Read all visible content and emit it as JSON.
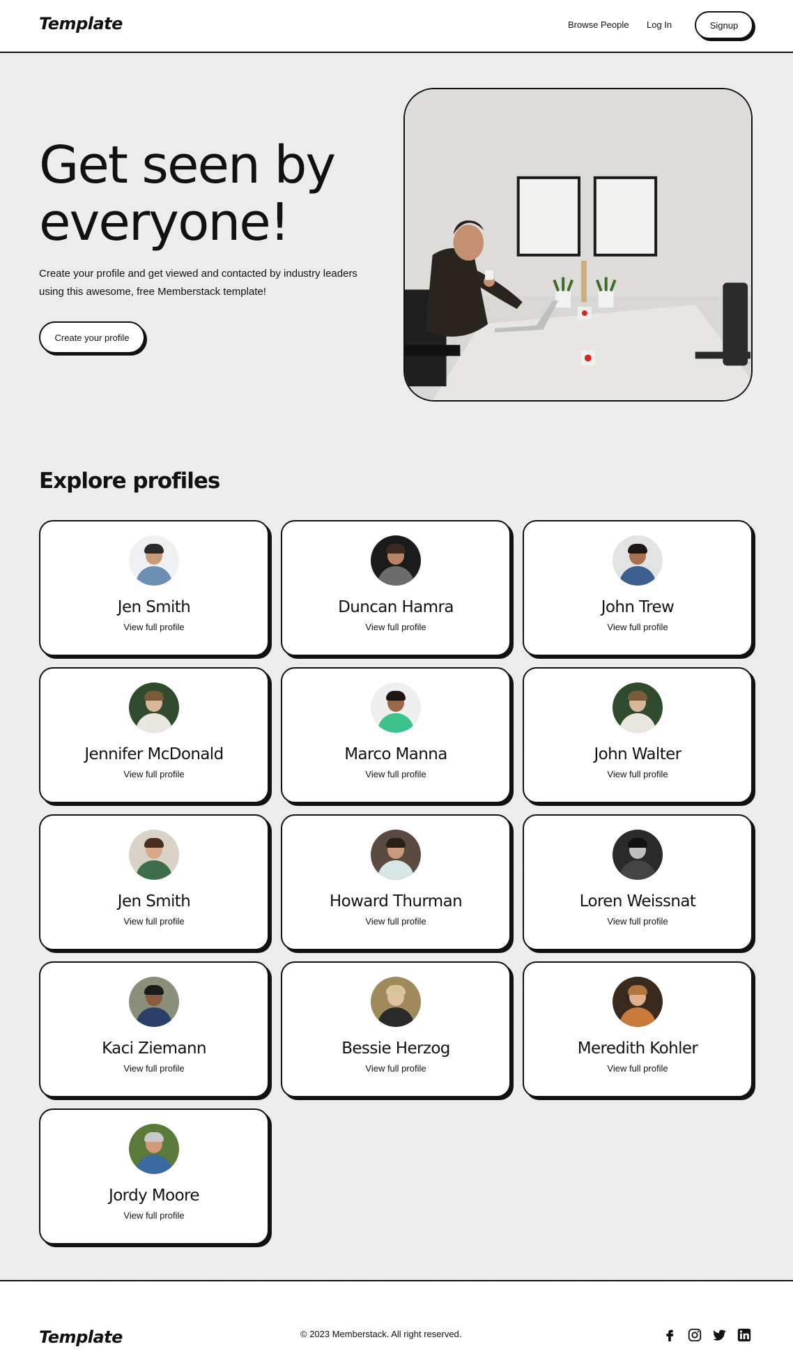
{
  "header": {
    "logo": "Template",
    "nav": {
      "browse": "Browse People",
      "login": "Log In",
      "signup": "Signup"
    }
  },
  "hero": {
    "title": "Get seen by everyone!",
    "description": "Create your profile and get viewed and contacted by industry leaders using this awesome, free Memberstack template!",
    "button": "Create your profile"
  },
  "profiles": {
    "title": "Explore profiles",
    "link_label": "View full profile",
    "items": [
      {
        "name": "Jen Smith",
        "colors": {
          "bg": "#eef0f2",
          "skin": "#c99a78",
          "shirt": "#6c8fb3",
          "hair": "#2a2a2a"
        }
      },
      {
        "name": "Duncan Hamra",
        "colors": {
          "bg": "#1b1b1b",
          "skin": "#b98466",
          "shirt": "#6b6b6b",
          "hair": "#3a2a20"
        }
      },
      {
        "name": "John Trew",
        "colors": {
          "bg": "#e3e3e3",
          "skin": "#a8704f",
          "shirt": "#3c5f8f",
          "hair": "#1e1712"
        }
      },
      {
        "name": "Jennifer McDonald",
        "colors": {
          "bg": "#2f4a2c",
          "skin": "#d8b69a",
          "shirt": "#e9e6df",
          "hair": "#7a5c3a"
        }
      },
      {
        "name": "Marco Manna",
        "colors": {
          "bg": "#eeeeee",
          "skin": "#9a6748",
          "shirt": "#3cc28a",
          "hair": "#1f1712"
        }
      },
      {
        "name": "John Walter",
        "colors": {
          "bg": "#2f4a2c",
          "skin": "#d8b69a",
          "shirt": "#e9e6df",
          "hair": "#7a5c3a"
        }
      },
      {
        "name": "Jen Smith",
        "colors": {
          "bg": "#d9d2c6",
          "skin": "#d8a888",
          "shirt": "#3f6f4a",
          "hair": "#4a2e1e"
        }
      },
      {
        "name": "Howard Thurman",
        "colors": {
          "bg": "#5a4a40",
          "skin": "#c99a7c",
          "shirt": "#d9e4e4",
          "hair": "#2a201a"
        }
      },
      {
        "name": "Loren Weissnat",
        "colors": {
          "bg": "#2a2a2a",
          "skin": "#bfbfbf",
          "shirt": "#444444",
          "hair": "#111111"
        }
      },
      {
        "name": "Kaci Ziemann",
        "colors": {
          "bg": "#8a8f7a",
          "skin": "#8a5a40",
          "shirt": "#2a3f6a",
          "hair": "#1a1a1a"
        }
      },
      {
        "name": "Bessie Herzog",
        "colors": {
          "bg": "#a08a5c",
          "skin": "#e0c0a0",
          "shirt": "#2a2a2a",
          "hair": "#d8c49a"
        }
      },
      {
        "name": "Meredith Kohler",
        "colors": {
          "bg": "#3a2a1e",
          "skin": "#e0b08a",
          "shirt": "#c97a3a",
          "hair": "#b0763e"
        }
      },
      {
        "name": "Jordy Moore",
        "colors": {
          "bg": "#5a7a3a",
          "skin": "#d09a7a",
          "shirt": "#3a6aa0",
          "hair": "#c8c8c8"
        }
      }
    ]
  },
  "footer": {
    "logo": "Template",
    "copyright": "© 2023 Memberstack. All right reserved.",
    "social_icons": [
      "facebook-icon",
      "instagram-icon",
      "twitter-icon",
      "linkedin-icon"
    ]
  }
}
